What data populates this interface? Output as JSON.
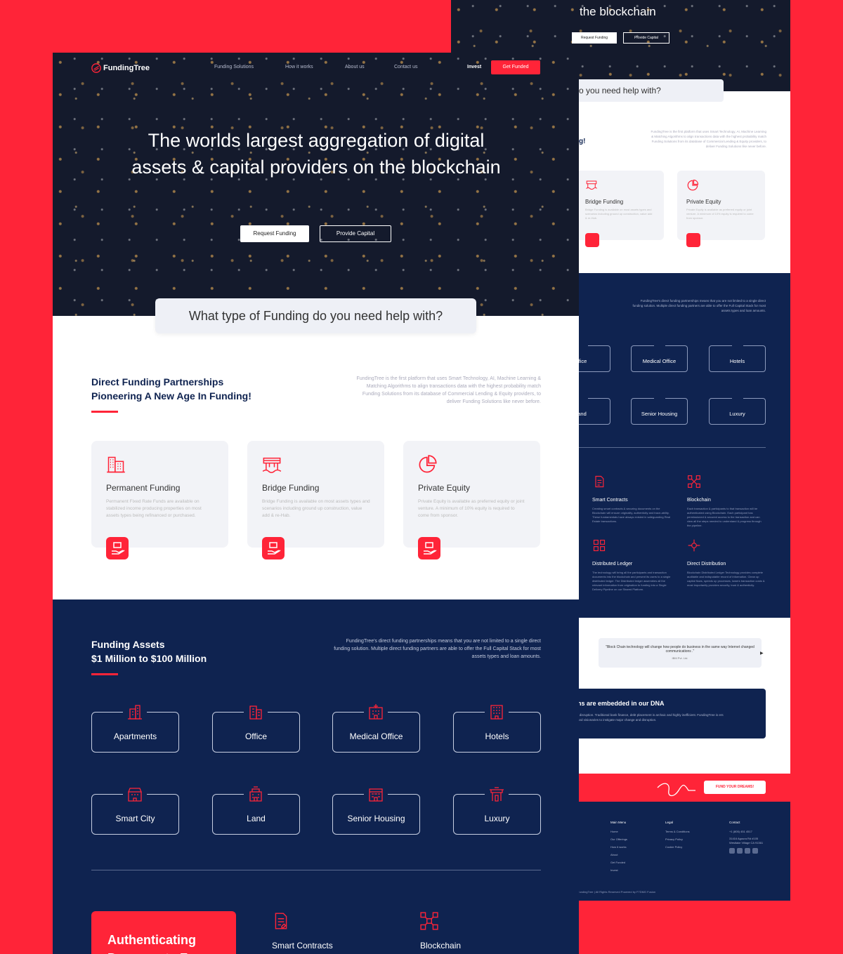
{
  "brand": {
    "name": "FundingTree",
    "accent": "#ff2438",
    "navy": "#0f2350"
  },
  "nav": {
    "items": [
      "Funding Solutions",
      "How it works",
      "About us",
      "Contact us"
    ],
    "invest": "Invest",
    "get_funded": "Get Funded"
  },
  "hero": {
    "title": "The worlds largest aggregation of digital assets & capital providers on the blockchain",
    "request_button": "Request Funding",
    "provide_button": "Provide Capital"
  },
  "question": "What type of Funding do you need help with?",
  "direct": {
    "heading_line1": "Direct Funding Partnerships",
    "heading_line2": "Pioneering A New Age In Funding!",
    "paragraph": "FundingTree is the first platform that uses Smart Technology, AI, Machine Learning & Matching Algorithms to align transactions data with the highest probability match Funding Solutions from its  database of Commercial Lending & Equity providers, to deliver Funding Solutions like never before."
  },
  "cards": [
    {
      "title": "Permanent Funding",
      "desc": "Permanent Fixed Rate Funds are available on stabilized income producing properties on most assets types being refinanced or purchased.",
      "icon": "building-icon"
    },
    {
      "title": "Bridge Funding",
      "desc": "Bridge Funding is available on most assets types and scenarios including ground up construction, value add & re-Hab.",
      "icon": "bridge-icon"
    },
    {
      "title": "Private Equity",
      "desc": "Private Equity is available as preferred equity or joint venture. A minimum of 10% equity is required to come from sponsor.",
      "icon": "pie-chart-icon"
    }
  ],
  "assets": {
    "heading_line1": "Funding Assets",
    "heading_line2": "$1 Million to $100 Million",
    "paragraph": "FundingTree's direct funding partnerships means that you are not limited to a single direct funding solution. Multiple direct funding partners are able to offer the Full Capital Stack for most assets types and loan amounts.",
    "types": [
      "Apartments",
      "Office",
      "Medical Office",
      "Hotels",
      "Smart City",
      "Land",
      "Senior Housing",
      "Luxury"
    ]
  },
  "features": {
    "auth_title": "Authenticating Documents For",
    "items": [
      "Smart Contracts",
      "Blockchain",
      "Distributed Ledger",
      "Direct Distribution"
    ],
    "descs": [
      "Creating smart contracts & securing documents on the Blockchain will ensure originality, authenticity and trace-ability. These fundamentals have always existed in safeguarding Real Estate transactions.",
      "Each transaction & participants to that transaction will be authenticated using Blockchain. Each participant has permissioned & secured access to the transaction and can view all the steps needed to understand & progress through the pipeline.",
      "The technology will bring all the participants and transaction documents into the blockchain and present its users to a single distributed ledger. The Distributed ledger assembles all the relevant information from origination to funding into a Single Delivery Pipeline on our Shared Platform.",
      "Blockchain Distributed Ledger Technology provides complete auditable and indisputable record of information. Clean up capital flows, speeds up processes, lowers transaction costs & most importantly provides security, trust & authenticity."
    ]
  },
  "quote": {
    "text": "\"Block Chain technology will change how people do business in the same way Internet changed communications .\"",
    "author": "IBM Pvt. Ltd."
  },
  "dna": {
    "heading": "ns are embedded in our DNA",
    "text": "r disruption. Traditional bank finance, debt placement is archaic and highly inefficient. FundingTree is ers and visionaries to instigate major change and disruption."
  },
  "cta": {
    "button": "FUND YOUR DREAMS!"
  },
  "footer": {
    "main_menu": {
      "heading": "Main Menu",
      "items": [
        "Home",
        "Our Offerings",
        "How it works",
        "About",
        "Get Funded",
        "Invest"
      ]
    },
    "legal": {
      "heading": "Legal",
      "items": [
        "Terms & Conditions",
        "Privacy Policy",
        "Cookie Policy"
      ]
    },
    "contact": {
      "heading": "Contact",
      "phone": "+1 (805) 451 4517",
      "address": "31416 Agoura Rd #105 Westlake Village CA 91361"
    },
    "copyright": "FundingTree | All Rights Reserved Powered by F7DMG Fusion"
  },
  "back_page": {
    "hero_title": "the blockchain",
    "question": "f Funding do you need help with?",
    "heading_fragment": "g!",
    "tiles": [
      "ffice",
      "Medical Office",
      "Hotels",
      "and",
      "Senior Housing",
      "Luxury"
    ],
    "quote_prev": "◀",
    "quote_next": "▶"
  }
}
